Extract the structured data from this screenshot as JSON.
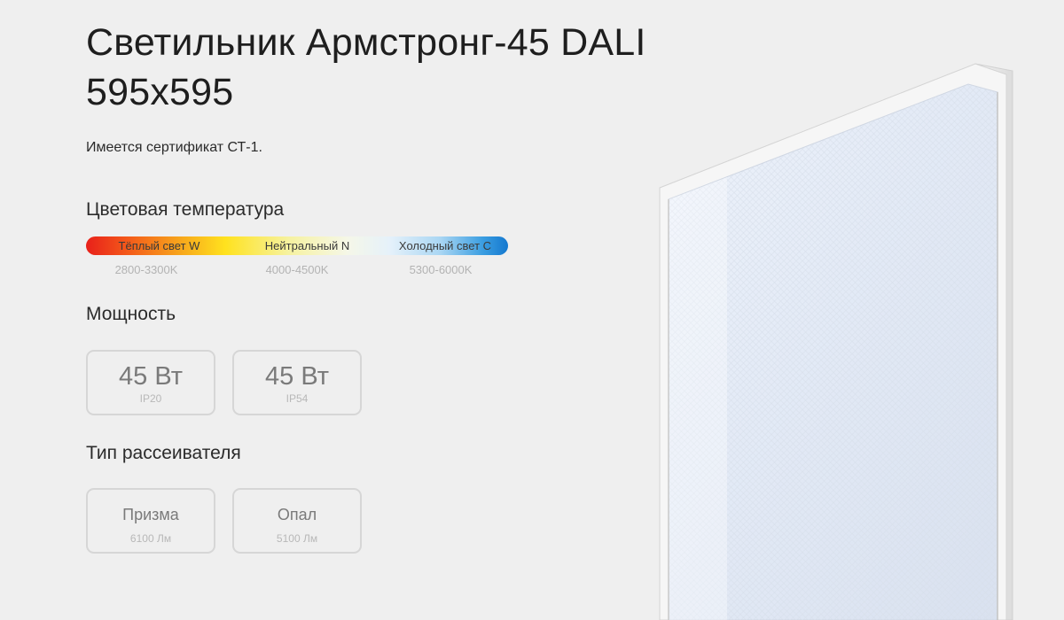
{
  "product": {
    "title_line1": "Светильник Армстронг-45 DALI",
    "title_line2": "595х595",
    "certificate": "Имеется сертификат СТ-1."
  },
  "color_temperature": {
    "label": "Цветовая температура",
    "options": [
      {
        "name": "Тёплый свет W",
        "range": "2800-3300K"
      },
      {
        "name": "Нейтральный N",
        "range": "4000-4500K"
      },
      {
        "name": "Холодный свет C",
        "range": "5300-6000K"
      }
    ]
  },
  "power": {
    "label": "Мощность",
    "options": [
      {
        "value": "45 Вт",
        "protection": "IP20"
      },
      {
        "value": "45 Вт",
        "protection": "IP54"
      }
    ]
  },
  "diffuser": {
    "label": "Тип рассеивателя",
    "options": [
      {
        "name": "Призма",
        "flux": "6100 Лм"
      },
      {
        "name": "Опал",
        "flux": "5100 Лм"
      }
    ]
  },
  "image": {
    "icon": "led-panel-image"
  }
}
